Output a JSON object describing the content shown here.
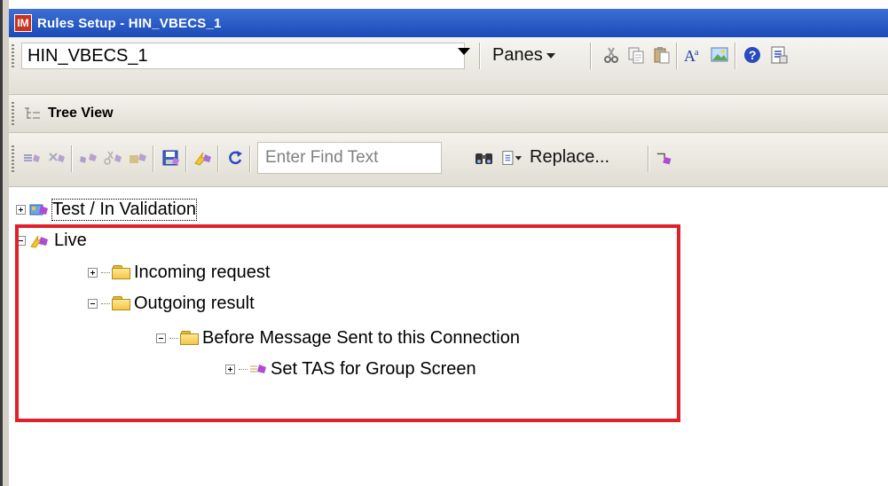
{
  "window": {
    "app_icon_text": "IM",
    "title": "Rules Setup - HIN_VBECS_1"
  },
  "toolbar": {
    "connection_value": "HIN_VBECS_1",
    "panes_label": "Panes",
    "icons": [
      "cut-icon",
      "copy-icon",
      "paste-icon",
      "font-icon",
      "image-icon",
      "help-icon",
      "properties-icon"
    ]
  },
  "tree_view_bar": {
    "label": "Tree View"
  },
  "find_toolbar": {
    "find_placeholder": "Enter Find Text",
    "replace_label": "Replace...",
    "icons": [
      "add-rule-icon",
      "delete-rule-icon",
      "move-icon",
      "cut-rule-icon",
      "export-icon",
      "save-icon",
      "activate-icon",
      "refresh-icon",
      "find-icon",
      "find-options-icon",
      "next-icon"
    ]
  },
  "tree": {
    "nodes": [
      {
        "label": "Test / In Validation",
        "expander": "+"
      },
      {
        "label": "Live",
        "expander": "-"
      },
      {
        "label": "Incoming request",
        "expander": "+"
      },
      {
        "label": "Outgoing result",
        "expander": "-"
      },
      {
        "label": "Before Message Sent to this Connection",
        "expander": "-"
      },
      {
        "label": "Set TAS for Group Screen",
        "expander": "+"
      }
    ]
  },
  "colors": {
    "titlebar": "#1a4bb8",
    "highlight_box": "#e0202a",
    "folder": "#f3c64a"
  }
}
